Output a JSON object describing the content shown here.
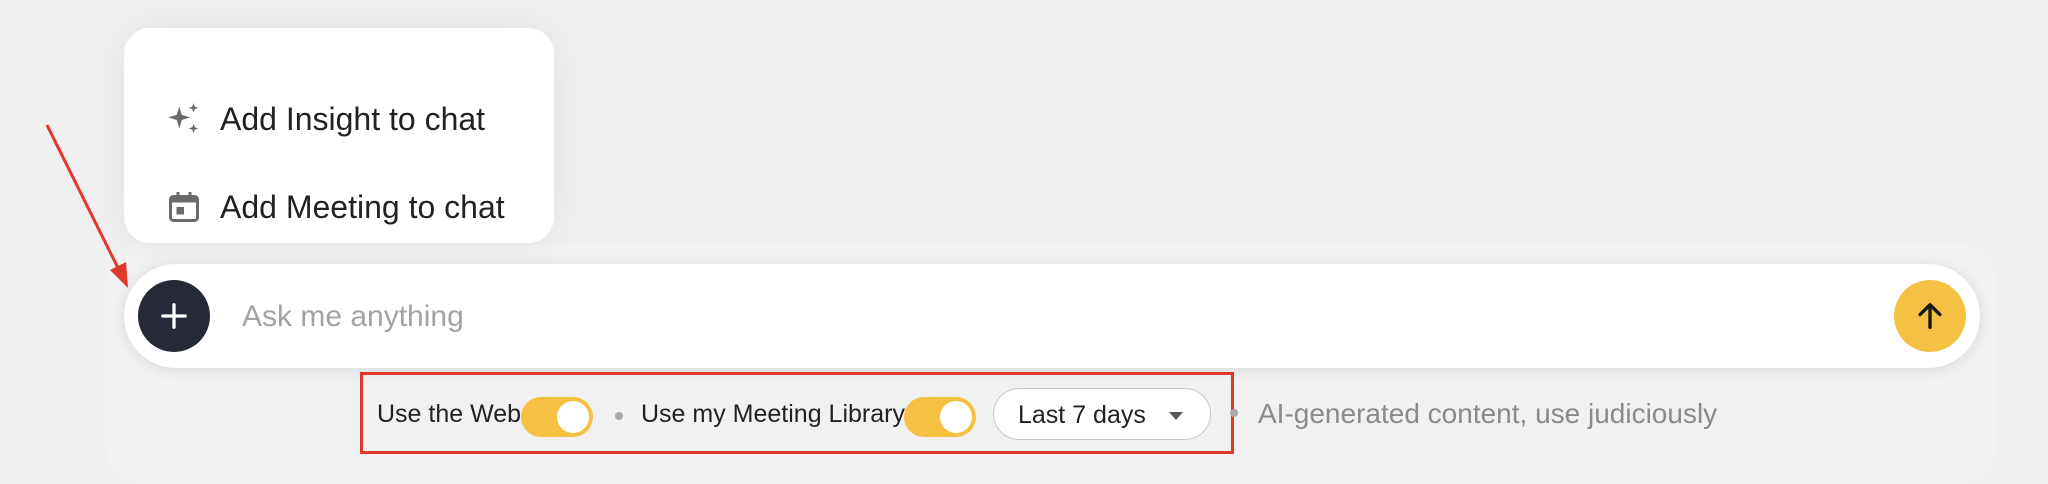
{
  "attach_menu": {
    "items": [
      {
        "label": "Add Insight to chat",
        "icon": "sparkle-icon"
      },
      {
        "label": "Add Meeting to chat",
        "icon": "calendar-icon"
      }
    ]
  },
  "composer": {
    "placeholder": "Ask me anything",
    "add_icon": "plus-icon",
    "send_icon": "arrow-up-icon"
  },
  "options": {
    "web_label": "Use the Web",
    "web_enabled": true,
    "library_label": "Use my Meeting Library",
    "library_enabled": true,
    "time_range": "Last 7 days"
  },
  "disclaimer": "AI-generated content, use judiciously",
  "colors": {
    "accent": "#f5c143",
    "dark_button": "#262a36",
    "annotation": "#e0392b"
  }
}
